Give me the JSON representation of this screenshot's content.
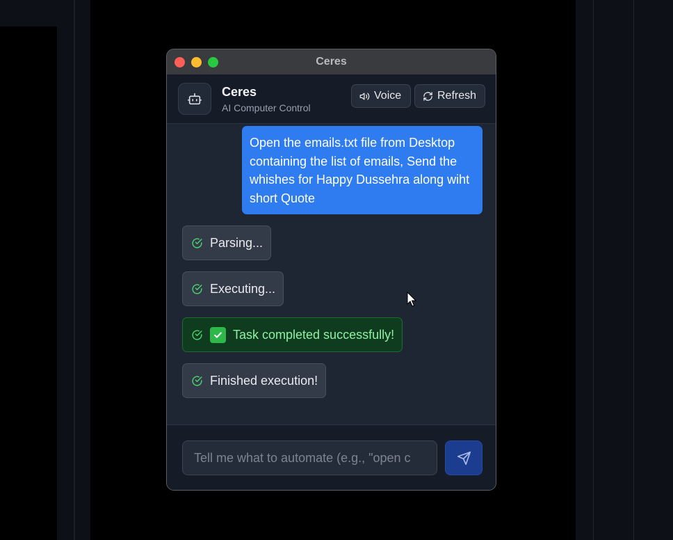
{
  "window": {
    "title": "Ceres"
  },
  "header": {
    "app_name": "Ceres",
    "subtitle": "AI Computer Control",
    "voice_label": "Voice",
    "refresh_label": "Refresh"
  },
  "chat": {
    "user_message": "Open the emails.txt file from Desktop containing the list of emails, Send the whishes for Happy Dussehra along wiht short Quote",
    "statuses": [
      {
        "text": "Parsing...",
        "kind": "neutral"
      },
      {
        "text": "Executing...",
        "kind": "neutral"
      },
      {
        "text": "Task completed successfully!",
        "kind": "success",
        "emoji": "check-mark-button"
      },
      {
        "text": "Finished execution!",
        "kind": "neutral"
      }
    ]
  },
  "composer": {
    "placeholder": "Tell me what to automate (e.g., \"open c",
    "value": ""
  },
  "icons": {
    "bot": "robot-icon",
    "voice": "speaker-icon",
    "refresh": "refresh-icon",
    "status": "check-circle-icon",
    "send": "send-icon"
  },
  "colors": {
    "accent": "#2f7bf0",
    "success_bg": "#0f3c1f",
    "success_text": "#8ff0a4",
    "send_button": "#1c3d8f"
  }
}
